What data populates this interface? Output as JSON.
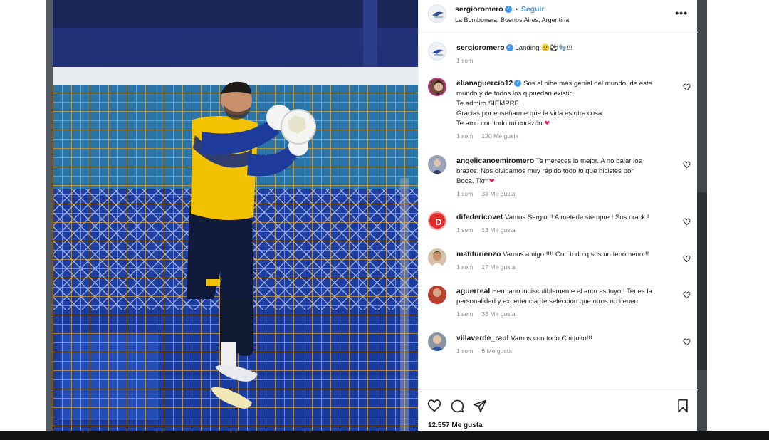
{
  "post": {
    "username": "sergioromero",
    "follow_label": "Seguir",
    "location": "La Bombonera, Buenos Aires, Argentina",
    "caption_text": "Landing 🫡⚽🧤!!!",
    "caption_time": "1 sem",
    "likes_text": "12.557 Me gusta"
  },
  "comments": [
    {
      "username": "elianaguercio12",
      "verified": true,
      "lines": [
        "Sos el pibe más genial del mundo, de este",
        "mundo y de todos los q puedan existir.",
        "Te admiro SIEMPRE.",
        "Gracias por enseñarme que la vida es otra cosa.",
        "Te amo con todo mi corazón"
      ],
      "time": "1 sem",
      "likes": "120 Me gusta"
    },
    {
      "username": "angelicanoemiromero",
      "lines": [
        "Te mereces lo mejor. A no bajar los",
        "brazos. Nos olvidamos muy rápido todo lo que hicistes por",
        "Boca. Tkm"
      ],
      "time": "1 sem",
      "likes": "33 Me gusta"
    },
    {
      "username": "difedericovet",
      "lines": [
        "Vamos Sergio !! A meterle siempre ! Sos crack !"
      ],
      "time": "1 sem",
      "likes": "13 Me gusta"
    },
    {
      "username": "matiturienzo",
      "lines": [
        "Vamos amigo !!!! Con todo q sos un fenómeno !!"
      ],
      "time": "1 sem",
      "likes": "17 Me gusta"
    },
    {
      "username": "aguerreal",
      "lines": [
        "Hermano indiscutiblemente el arco es tuyo!! Tenes la",
        "personalidad y experiencia de selección que otros no tienen"
      ],
      "time": "1 sem",
      "likes": "33 Me gusta"
    },
    {
      "username": "villaverde_raul",
      "lines": [
        "Vamos con todo Chiquito!!!"
      ],
      "time": "1 sem",
      "likes": "6 Me gusta"
    }
  ],
  "icons": {
    "like": "heart-outline-icon",
    "comment": "comment-bubble-icon",
    "share": "paper-plane-icon",
    "save": "bookmark-icon",
    "more": "more-options-icon"
  },
  "colors": {
    "accent_blue": "#3897f0",
    "jersey_yellow": "#f2c200",
    "pitch_blue": "#1a3fa0"
  }
}
